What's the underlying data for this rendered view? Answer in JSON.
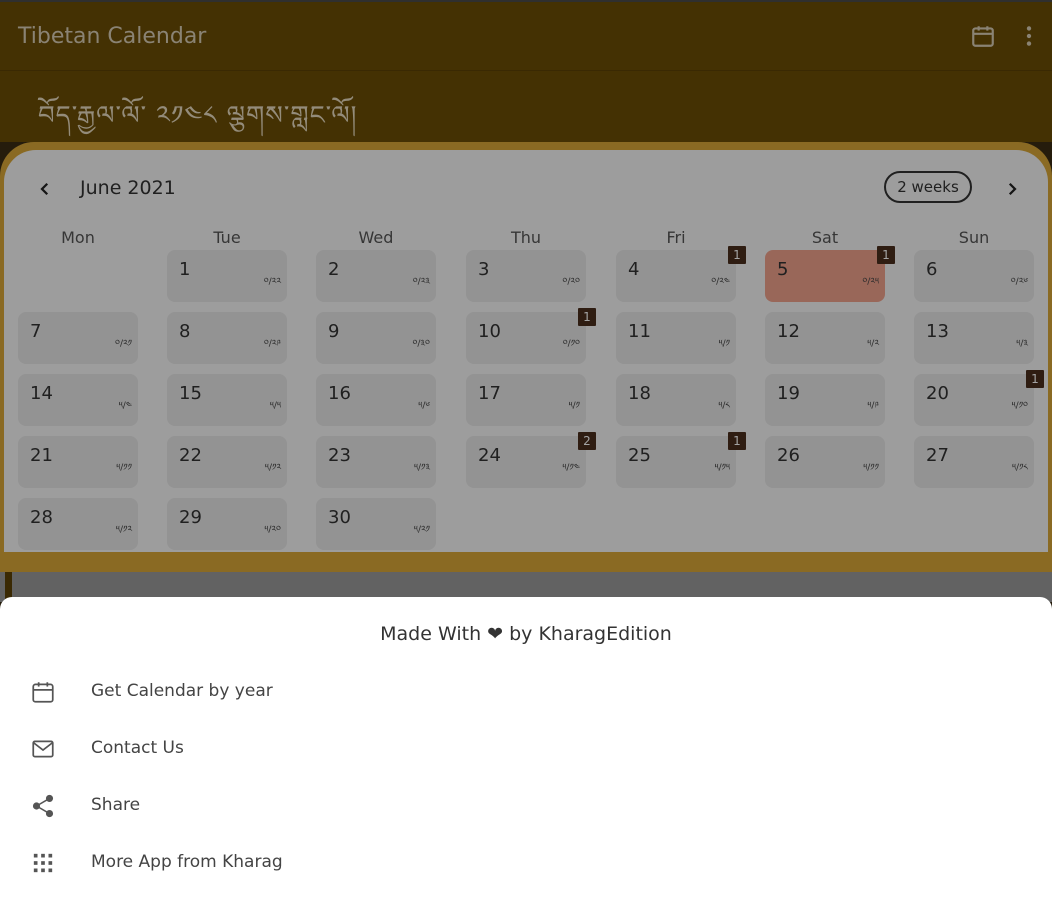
{
  "app": {
    "title": "Tibetan Calendar",
    "tibetan_title": "བོད་རྒྱལ་ལོ་ ༢༡༤༨ ལྕགས་གླང་ལོ།"
  },
  "calendar": {
    "month": "June 2021",
    "format_button": "2 weeks",
    "weekdays": [
      "Mon",
      "Tue",
      "Wed",
      "Thu",
      "Fri",
      "Sat",
      "Sun"
    ],
    "days": [
      {
        "day": "1",
        "tib": "༠/༢༢",
        "badge": ""
      },
      {
        "day": "2",
        "tib": "༠/༢༣",
        "badge": ""
      },
      {
        "day": "3",
        "tib": "༠/༢༠",
        "badge": ""
      },
      {
        "day": "4",
        "tib": "༠/༢༤",
        "badge": "1"
      },
      {
        "day": "5",
        "tib": "༠/༢༥",
        "badge": "1",
        "selected": true
      },
      {
        "day": "6",
        "tib": "༠/༢༦",
        "badge": ""
      },
      {
        "day": "7",
        "tib": "༠/༢༡",
        "badge": ""
      },
      {
        "day": "8",
        "tib": "༠/༢༩",
        "badge": ""
      },
      {
        "day": "9",
        "tib": "༠/༣༠",
        "badge": ""
      },
      {
        "day": "10",
        "tib": "༠/༡༠",
        "badge": "1"
      },
      {
        "day": "11",
        "tib": "༥/༡",
        "badge": ""
      },
      {
        "day": "12",
        "tib": "༥/༢",
        "badge": ""
      },
      {
        "day": "13",
        "tib": "༥/༣",
        "badge": ""
      },
      {
        "day": "14",
        "tib": "༥/༤",
        "badge": ""
      },
      {
        "day": "15",
        "tib": "༥/༥",
        "badge": ""
      },
      {
        "day": "16",
        "tib": "༥/༦",
        "badge": ""
      },
      {
        "day": "17",
        "tib": "༥/༡",
        "badge": ""
      },
      {
        "day": "18",
        "tib": "༥/༨",
        "badge": ""
      },
      {
        "day": "19",
        "tib": "༥/༩",
        "badge": ""
      },
      {
        "day": "20",
        "tib": "༥/༡༠",
        "badge": "1"
      },
      {
        "day": "21",
        "tib": "༥/༡༡",
        "badge": ""
      },
      {
        "day": "22",
        "tib": "༥/༡༢",
        "badge": ""
      },
      {
        "day": "23",
        "tib": "༥/༡༣",
        "badge": ""
      },
      {
        "day": "24",
        "tib": "༥/༡༤",
        "badge": "2"
      },
      {
        "day": "25",
        "tib": "༥/༡༥",
        "badge": "1"
      },
      {
        "day": "26",
        "tib": "༥/༡༡",
        "badge": ""
      },
      {
        "day": "27",
        "tib": "༥/༡༨",
        "badge": ""
      },
      {
        "day": "28",
        "tib": "༥/༡༢",
        "badge": ""
      },
      {
        "day": "29",
        "tib": "༥/༢༠",
        "badge": ""
      },
      {
        "day": "30",
        "tib": "༥/༢༡",
        "badge": ""
      }
    ]
  },
  "sheet": {
    "title": "Made With ❤ by KharagEdition",
    "items": [
      {
        "label": "Get Calendar by year",
        "icon": "calendar-icon"
      },
      {
        "label": "Contact Us",
        "icon": "mail-icon"
      },
      {
        "label": "Share",
        "icon": "share-icon"
      },
      {
        "label": "More App from Kharag",
        "icon": "apps-grid-icon"
      }
    ]
  },
  "colors": {
    "appbar": "#6b4d06",
    "frame": "#d8a637",
    "selected": "#f0a18c",
    "badge": "#4a2e1d"
  }
}
